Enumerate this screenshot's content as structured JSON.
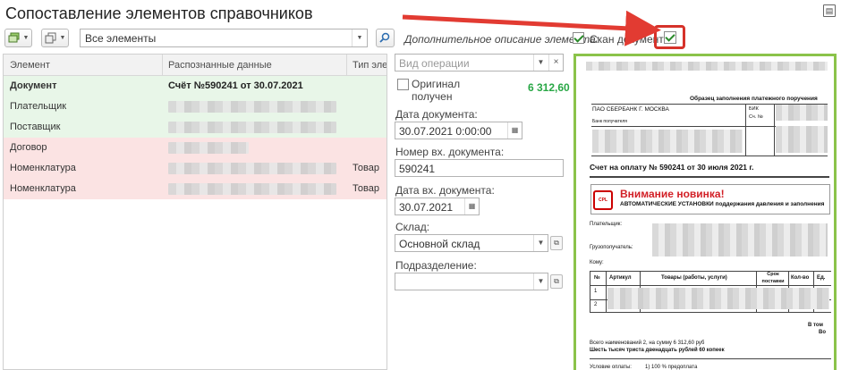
{
  "title": "Сопоставление элементов справочников",
  "toolbar": {
    "filter_value": "Все элементы",
    "desc_label": "Дополнительное описание элемента:",
    "scan_label": "Скан документа:"
  },
  "table": {
    "columns": [
      "Элемент",
      "Распознанные данные",
      "Тип эле..."
    ],
    "rows": [
      {
        "element": "Документ",
        "data": "Счёт №590241 от 30.07.2021",
        "type": "",
        "state": "green"
      },
      {
        "element": "Плательщик",
        "data": "",
        "type": "",
        "state": "green"
      },
      {
        "element": "Поставщик",
        "data": "",
        "type": "",
        "state": "green"
      },
      {
        "element": "Договор",
        "data": "",
        "type": "",
        "state": "red"
      },
      {
        "element": "Номенклатура",
        "data": "",
        "type": "Товар",
        "state": "red"
      },
      {
        "element": "Номенклатура",
        "data": "",
        "type": "Товар",
        "state": "red"
      }
    ]
  },
  "form": {
    "operation_placeholder": "Вид операции",
    "original_label": "Оригинал получен",
    "amount": "6 312,60",
    "doc_date_label": "Дата документа:",
    "doc_date_value": "30.07.2021  0:00:00",
    "in_number_label": "Номер вх. документа:",
    "in_number_value": "590241",
    "in_date_label": "Дата вх. документа:",
    "in_date_value": "30.07.2021",
    "warehouse_label": "Склад:",
    "warehouse_value": "Основной склад",
    "department_label": "Подразделение:"
  },
  "preview": {
    "sample_title": "Образец заполнения платежного поручения",
    "bank": "ПАО СБЕРБАНК Г. МОСКВА",
    "bik": "БИК",
    "account": "Сч. №",
    "bank_recipient": "Банк получателя",
    "invoice_title": "Счет на оплату № 590241 от 30 июля 2021 г.",
    "ad_title": "Внимание новинка!",
    "ad_subtitle": "АВТОМАТИЧЕСКИЕ УСТАНОВКИ поддержания давления и заполнения",
    "logo_text": "CPL",
    "payer": "Плательщик:",
    "consignee": "Грузополучатель:",
    "to": "Кому:",
    "col_no": "№",
    "col_article": "Артикул",
    "col_goods": "Товары (работы, услуги)",
    "col_term": "Срок поставки",
    "col_qty": "Кол-во",
    "col_unit": "Ед.",
    "row1": "1",
    "row2": "2",
    "in_total": "В том",
    "total_frag": "Во",
    "total_items": "Всего наименований 2, на сумму 6 312,60 руб",
    "total_words": "Шесть тысяч триста двенадцать рублей 60 копеек",
    "payment_terms": "Условие оплаты:",
    "payment_value": "1) 100 % предоплата"
  },
  "colors": {
    "green_row": "#e8f6e8",
    "red_row": "#fbe3e3",
    "amount": "#28a745",
    "preview_border": "#8bc34a",
    "highlight": "#d6322a"
  }
}
